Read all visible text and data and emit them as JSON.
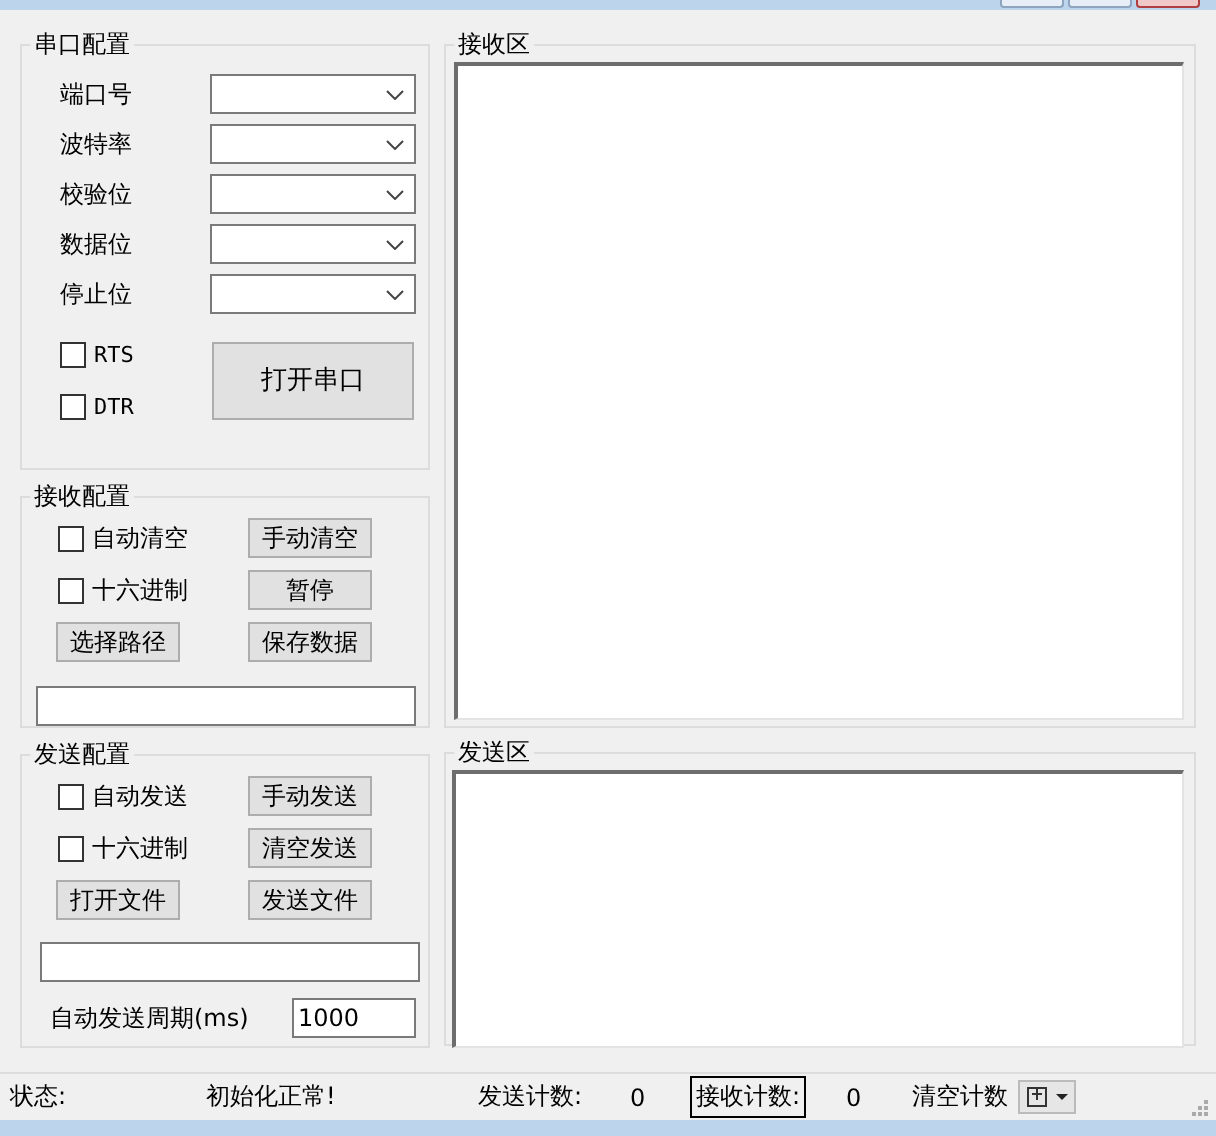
{
  "serial": {
    "title": "串口配置",
    "fields": [
      {
        "label": "端口号"
      },
      {
        "label": "波特率"
      },
      {
        "label": "校验位"
      },
      {
        "label": "数据位"
      },
      {
        "label": "停止位"
      }
    ],
    "checkboxes": [
      {
        "label": "RTS",
        "checked": false
      },
      {
        "label": "DTR",
        "checked": false
      }
    ],
    "open_button": "打开串口"
  },
  "receive": {
    "title": "接收配置",
    "cells": [
      {
        "kind": "checkbox",
        "label": "自动清空",
        "checked": false
      },
      {
        "kind": "button",
        "label": "手动清空"
      },
      {
        "kind": "checkbox",
        "label": "十六进制",
        "checked": false
      },
      {
        "kind": "button",
        "label": "暂停"
      },
      {
        "kind": "button",
        "label": "选择路径"
      },
      {
        "kind": "button",
        "label": "保存数据"
      }
    ]
  },
  "send": {
    "title": "发送配置",
    "cells": [
      {
        "kind": "checkbox",
        "label": "自动发送",
        "checked": false
      },
      {
        "kind": "button",
        "label": "手动发送"
      },
      {
        "kind": "checkbox",
        "label": "十六进制",
        "checked": false
      },
      {
        "kind": "button",
        "label": "清空发送"
      },
      {
        "kind": "button",
        "label": "打开文件"
      },
      {
        "kind": "button",
        "label": "发送文件"
      }
    ],
    "period_label": "自动发送周期(ms)",
    "period_value": "1000"
  },
  "receive_area": {
    "title": "接收区"
  },
  "send_area": {
    "title": "发送区"
  },
  "status_bar": {
    "status_label": "状态:",
    "status_text": "初始化正常!",
    "send_count_label": "发送计数:",
    "send_count": "0",
    "receive_count_label": "接收计数:",
    "receive_count": "0",
    "clear_label": "清空计数"
  }
}
